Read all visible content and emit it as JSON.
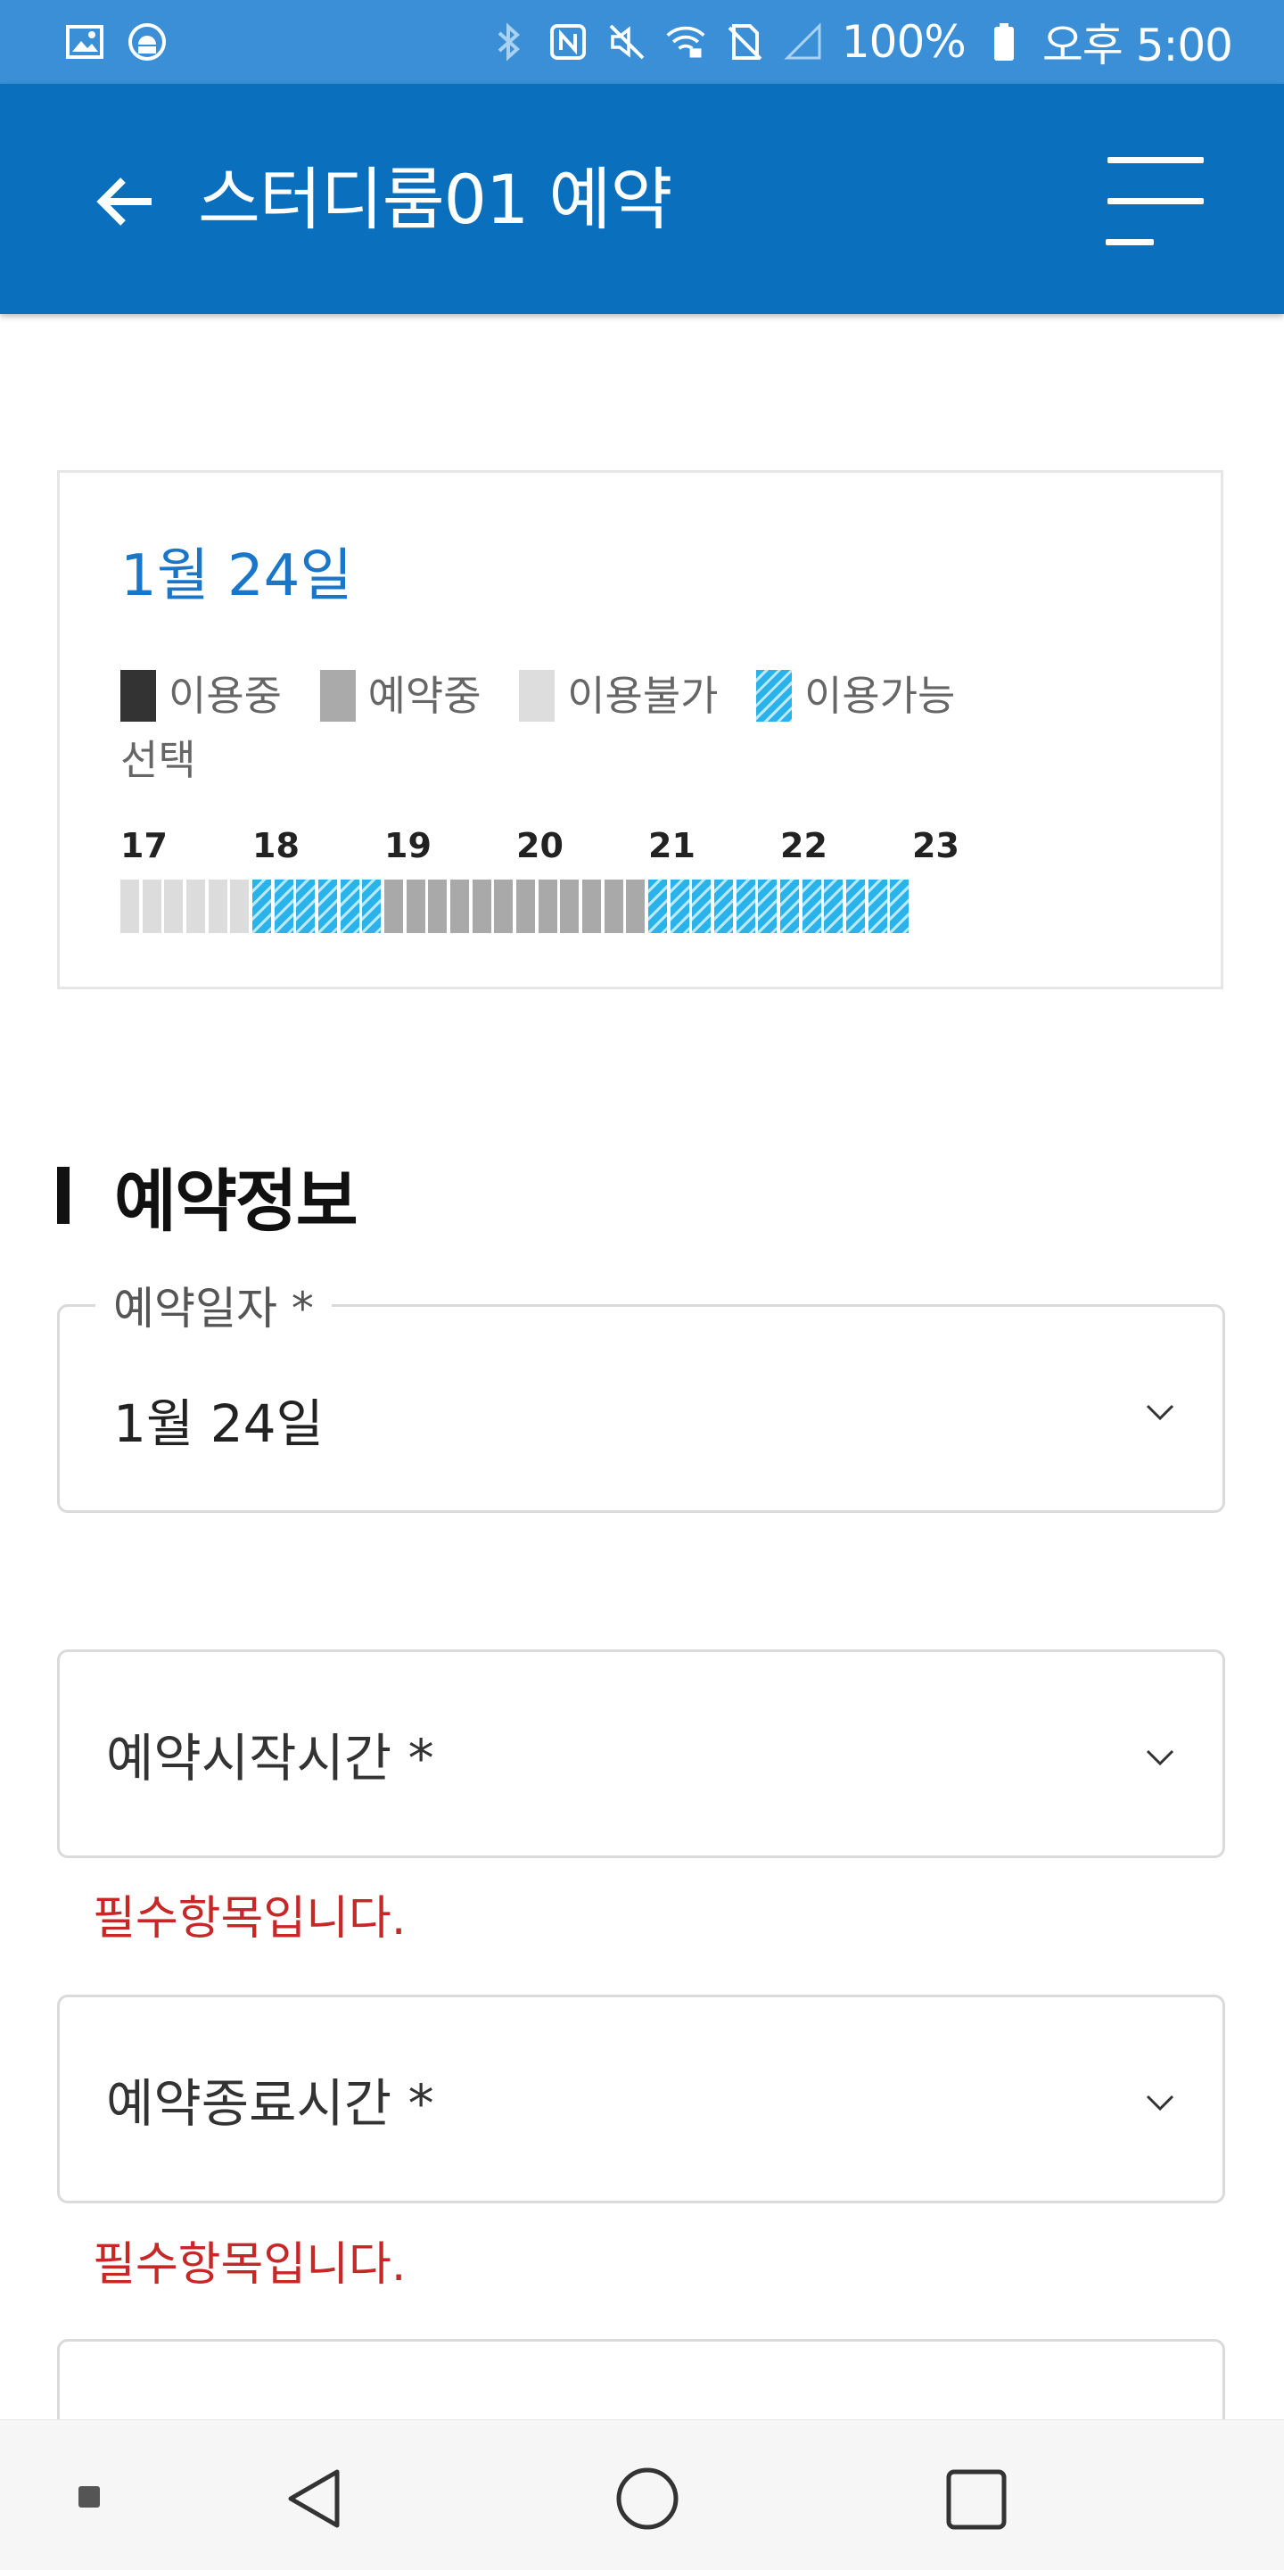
{
  "status_bar": {
    "battery_text": "100%",
    "time_text": "오후 5:00",
    "icons_left": [
      "gallery-icon",
      "android-debug-icon"
    ],
    "icons_right": [
      "bluetooth-icon",
      "nfc-icon",
      "mute-icon",
      "wifi-icon",
      "no-sim-icon",
      "signal-icon",
      "battery-icon"
    ]
  },
  "app_bar": {
    "title": "스터디룸01 예약",
    "color": "#0a6fbd"
  },
  "schedule": {
    "date": "1월 24일",
    "legend": [
      {
        "label": "이용중",
        "color": "#333333"
      },
      {
        "label": "예약중",
        "color": "#aaaaaa"
      },
      {
        "label": "이용불가",
        "color": "#dddddd"
      },
      {
        "label": "이용가능",
        "color": "#2ab3ea"
      },
      {
        "label": "선택",
        "color": "#e0344a"
      }
    ],
    "hours": [
      "17",
      "18",
      "19",
      "20",
      "21",
      "22",
      "23"
    ],
    "slots": [
      "unavailable",
      "unavailable",
      "unavailable",
      "unavailable",
      "unavailable",
      "unavailable",
      "available",
      "available",
      "available",
      "available",
      "available",
      "available",
      "reserved",
      "reserved",
      "reserved",
      "reserved",
      "reserved",
      "reserved",
      "reserved",
      "reserved",
      "reserved",
      "reserved",
      "reserved",
      "reserved",
      "available",
      "available",
      "available",
      "available",
      "available",
      "available",
      "available",
      "available",
      "available",
      "available",
      "available",
      "available"
    ]
  },
  "reservation": {
    "section_title": "예약정보",
    "date_field": {
      "label": "예약일자 *",
      "value": "1월 24일"
    },
    "start_field": {
      "placeholder": "예약시작시간 *",
      "error": "필수항목입니다."
    },
    "end_field": {
      "placeholder": "예약종료시간 *",
      "error": "필수항목입니다."
    }
  }
}
